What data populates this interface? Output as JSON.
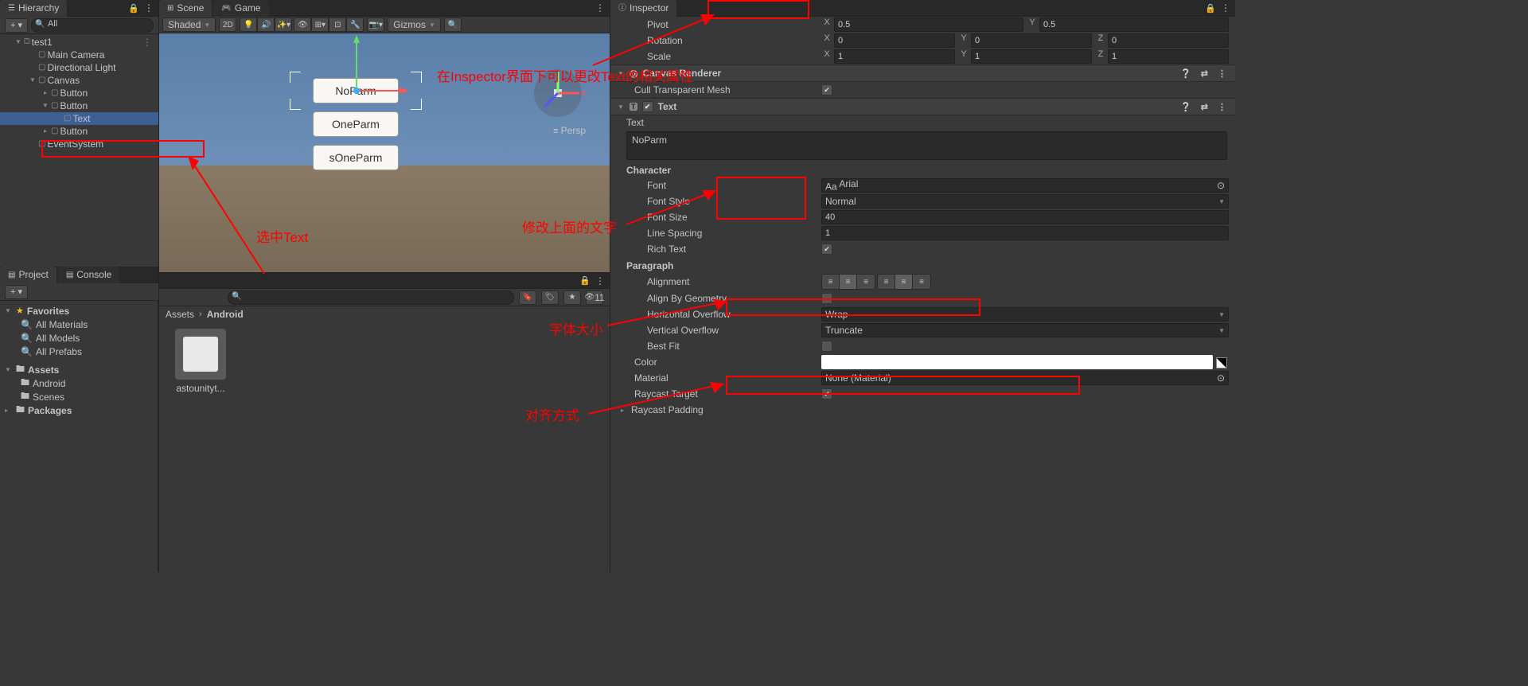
{
  "hierarchy": {
    "title": "Hierarchy",
    "search_placeholder": "All",
    "root": "test1",
    "items": [
      "Main Camera",
      "Directional Light",
      "Canvas",
      "Button",
      "Button",
      "Text",
      "Button",
      "EventSystem"
    ]
  },
  "scene": {
    "tab_scene": "Scene",
    "tab_game": "Game",
    "shading": "Shaded",
    "mode_2d": "2D",
    "gizmos": "Gizmos",
    "persp": "Persp",
    "btn1": "NoParm",
    "btn2": "OneParm",
    "btn3": "sOneParm"
  },
  "project": {
    "tab_project": "Project",
    "tab_console": "Console",
    "favorites": "Favorites",
    "fav1": "All Materials",
    "fav2": "All Models",
    "fav3": "All Prefabs",
    "assets": "Assets",
    "a1": "Android",
    "a2": "Scenes",
    "packages": "Packages",
    "bc1": "Assets",
    "bc2": "Android",
    "item1": "astounityt...",
    "hidden_count": "11"
  },
  "inspector": {
    "title": "Inspector",
    "pivot": "Pivot",
    "pivot_x": "0.5",
    "pivot_y": "0.5",
    "rotation": "Rotation",
    "rot_x": "0",
    "rot_y": "0",
    "rot_z": "0",
    "scale": "Scale",
    "scl_x": "1",
    "scl_y": "1",
    "scl_z": "1",
    "canvas_renderer": "Canvas Renderer",
    "cull_mesh": "Cull Transparent Mesh",
    "text_comp": "Text",
    "text_lbl": "Text",
    "text_val": "NoParm",
    "character": "Character",
    "font": "Font",
    "font_val": "Arial",
    "font_style": "Font Style",
    "font_style_val": "Normal",
    "font_size": "Font Size",
    "font_size_val": "40",
    "line_spacing": "Line Spacing",
    "line_spacing_val": "1",
    "rich_text": "Rich Text",
    "paragraph": "Paragraph",
    "alignment": "Alignment",
    "align_geom": "Align By Geometry",
    "h_overflow": "Horizontal Overflow",
    "h_overflow_val": "Wrap",
    "v_overflow": "Vertical Overflow",
    "v_overflow_val": "Truncate",
    "best_fit": "Best Fit",
    "color": "Color",
    "material": "Material",
    "material_val": "None (Material)",
    "raycast_target": "Raycast Target",
    "raycast_padding": "Raycast Padding"
  },
  "annotations": {
    "a1": "在Inspector界面下可以更改Text的相关属性",
    "a2": "选中Text",
    "a3": "修改上面的文字",
    "a4": "字体大小",
    "a5": "对齐方式"
  }
}
